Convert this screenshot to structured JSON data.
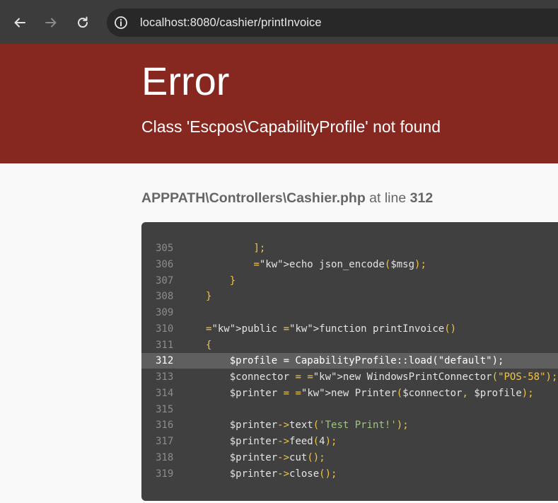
{
  "browser": {
    "url": "localhost:8080/cashier/printInvoice",
    "icons": {
      "back": "arrow-left-icon",
      "forward": "arrow-right-icon",
      "reload": "reload-icon",
      "site_info": "info-circle-icon"
    }
  },
  "error": {
    "title": "Error",
    "message": "Class 'Escpos\\CapabilityProfile' not found"
  },
  "location": {
    "file": "APPPATH\\Controllers\\Cashier.php",
    "at_line_text": "at line",
    "line": "312"
  },
  "code": {
    "highlighted_line": "312",
    "lines": [
      {
        "number": "305",
        "text": "        ];"
      },
      {
        "number": "306",
        "text": "        echo json_encode($msg);"
      },
      {
        "number": "307",
        "text": "    }"
      },
      {
        "number": "308",
        "text": "}"
      },
      {
        "number": "309",
        "text": ""
      },
      {
        "number": "310",
        "text": "public function printInvoice()"
      },
      {
        "number": "311",
        "text": "{"
      },
      {
        "number": "312",
        "text": "    $profile = CapabilityProfile::load(\"default\");"
      },
      {
        "number": "313",
        "text": "    $connector = new WindowsPrintConnector(\"POS-58\");"
      },
      {
        "number": "314",
        "text": "    $printer = new Printer($connector, $profile);"
      },
      {
        "number": "315",
        "text": ""
      },
      {
        "number": "316",
        "text": "    $printer->text('Test Print!');"
      },
      {
        "number": "317",
        "text": "    $printer->feed(4);"
      },
      {
        "number": "318",
        "text": "    $printer->cut();"
      },
      {
        "number": "319",
        "text": "    $printer->close();"
      }
    ]
  },
  "colors": {
    "error_header": "#862720",
    "code_background": "#404040",
    "highlight_line": "#5f5f5f",
    "keyword": "#f0c445",
    "string_single": "#9fc57d"
  }
}
